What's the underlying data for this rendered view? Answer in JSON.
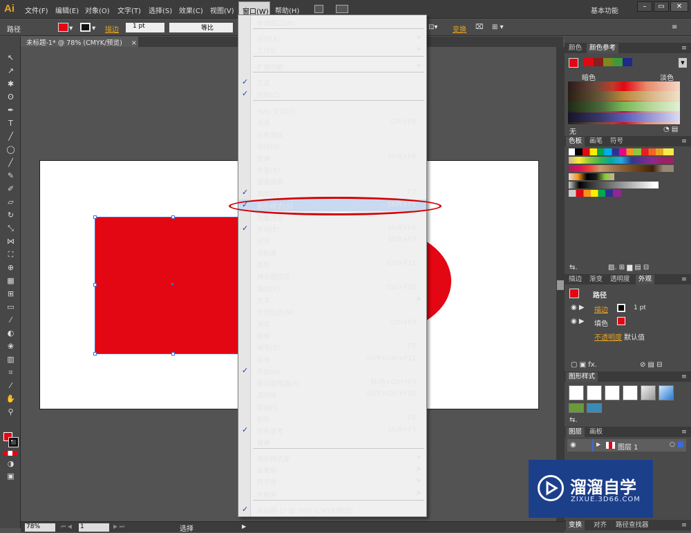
{
  "app": {
    "logo": "Ai",
    "workspace": "基本功能"
  },
  "menubar": {
    "items": [
      "文件(F)",
      "编辑(E)",
      "对象(O)",
      "文字(T)",
      "选择(S)",
      "效果(C)",
      "视图(V)",
      "窗口(W)",
      "帮助(H)"
    ],
    "active": "窗口(W)"
  },
  "window_controls": [
    "–",
    "▭",
    "✕"
  ],
  "control_bar": {
    "object_type": "路径",
    "stroke_label": "描边",
    "stroke_weight": "1 pt",
    "profile_label": "等比",
    "transform_label": "变换"
  },
  "document_tab": {
    "label": "未标题-1* @ 78% (CMYK/预览)",
    "close": "×"
  },
  "status_bar": {
    "zoom": "78%",
    "page": "1",
    "tool": "选择"
  },
  "canvas": {
    "shape_color": "#E30613"
  },
  "window_menu": {
    "highlighted": "图形样式(S)",
    "items": [
      {
        "label": "新建窗口(W)",
        "shortcut": "",
        "checked": false,
        "submenu": false
      },
      {
        "label": "排列(A)",
        "shortcut": "",
        "checked": false,
        "submenu": true
      },
      {
        "label": "工作区",
        "shortcut": "",
        "checked": false,
        "submenu": true
      },
      {
        "label": "扩展功能",
        "shortcut": "",
        "checked": false,
        "submenu": true
      },
      {
        "label": "工具",
        "shortcut": "",
        "checked": true,
        "submenu": false
      },
      {
        "label": "控制(C)",
        "shortcut": "",
        "checked": true,
        "submenu": false
      },
      {
        "label": "SVG 交互(Y)",
        "shortcut": "",
        "checked": false,
        "submenu": false
      },
      {
        "label": "信息",
        "shortcut": "Ctrl+F8",
        "checked": false,
        "submenu": false
      },
      {
        "label": "分色预览",
        "shortcut": "",
        "checked": false,
        "submenu": false
      },
      {
        "label": "动作(N)",
        "shortcut": "",
        "checked": false,
        "submenu": false
      },
      {
        "label": "变换",
        "shortcut": "Shift+F8",
        "checked": false,
        "submenu": false
      },
      {
        "label": "变量(R)",
        "shortcut": "",
        "checked": false,
        "submenu": false
      },
      {
        "label": "图像描摹",
        "shortcut": "",
        "checked": false,
        "submenu": false
      },
      {
        "label": "图层(L)",
        "shortcut": "F7",
        "checked": true,
        "submenu": false
      },
      {
        "label": "图形样式(S)",
        "shortcut": "Shift+F5",
        "checked": true,
        "submenu": false
      },
      {
        "label": "图案选项",
        "shortcut": "",
        "checked": false,
        "submenu": false
      },
      {
        "label": "外观(E)",
        "shortcut": "Shift+F6",
        "checked": true,
        "submenu": false
      },
      {
        "label": "对齐",
        "shortcut": "Shift+F7",
        "checked": false,
        "submenu": false
      },
      {
        "label": "导航器",
        "shortcut": "",
        "checked": false,
        "submenu": false
      },
      {
        "label": "属性",
        "shortcut": "Ctrl+F11",
        "checked": false,
        "submenu": false
      },
      {
        "label": "拼合器预览",
        "shortcut": "",
        "checked": false,
        "submenu": false
      },
      {
        "label": "描边(K)",
        "shortcut": "Ctrl+F10",
        "checked": false,
        "submenu": false
      },
      {
        "label": "文字",
        "shortcut": "",
        "checked": false,
        "submenu": true
      },
      {
        "label": "文档信息(M)",
        "shortcut": "",
        "checked": false,
        "submenu": false
      },
      {
        "label": "渐变",
        "shortcut": "Ctrl+F9",
        "checked": false,
        "submenu": false
      },
      {
        "label": "画板",
        "shortcut": "",
        "checked": false,
        "submenu": false
      },
      {
        "label": "画笔(B)",
        "shortcut": "F5",
        "checked": false,
        "submenu": false
      },
      {
        "label": "符号",
        "shortcut": "Shift+Ctrl+F11",
        "checked": false,
        "submenu": false
      },
      {
        "label": "色板(H)",
        "shortcut": "",
        "checked": true,
        "submenu": false
      },
      {
        "label": "路径查找器(P)",
        "shortcut": "Shift+Ctrl+F9",
        "checked": false,
        "submenu": false
      },
      {
        "label": "透明度",
        "shortcut": "Shift+Ctrl+F10",
        "checked": false,
        "submenu": false
      },
      {
        "label": "链接(I)",
        "shortcut": "",
        "checked": false,
        "submenu": false
      },
      {
        "label": "颜色",
        "shortcut": "F6",
        "checked": false,
        "submenu": false
      },
      {
        "label": "颜色参考",
        "shortcut": "Shift+F3",
        "checked": true,
        "submenu": false
      },
      {
        "label": "魔棒",
        "shortcut": "",
        "checked": false,
        "submenu": false
      },
      {
        "label": "图形样式库",
        "shortcut": "",
        "checked": false,
        "submenu": true
      },
      {
        "label": "画笔库",
        "shortcut": "",
        "checked": false,
        "submenu": true
      },
      {
        "label": "符号库",
        "shortcut": "",
        "checked": false,
        "submenu": true
      },
      {
        "label": "色板库",
        "shortcut": "",
        "checked": false,
        "submenu": true
      },
      {
        "label": "未标题-1* @ 78% (CMYK/预览)",
        "shortcut": "",
        "checked": true,
        "submenu": false
      }
    ]
  },
  "panels": {
    "color_tabs": [
      "颜色",
      "颜色参考"
    ],
    "color_guide": {
      "dark_label": "暗色",
      "light_label": "淡色",
      "none_label": "无"
    },
    "swatch_tabs": [
      "色板",
      "画笔",
      "符号"
    ],
    "appearance_tabs": [
      "描边",
      "渐变",
      "透明度",
      "外观"
    ],
    "appearance": {
      "title": "路径",
      "stroke_label": "描边",
      "stroke_weight": "1 pt",
      "fill_label": "填色",
      "opacity_label": "不透明度",
      "opacity_value": "默认值"
    },
    "graphic_styles_tab": "图形样式",
    "layers_tabs": [
      "图层",
      "画板"
    ],
    "layer_name": "图层 1",
    "bottom_tabs": [
      "变换",
      "对齐",
      "路径查找器"
    ]
  },
  "watermark": {
    "title": "溜溜自学",
    "subtitle": "ZIXUE.3D66.COM"
  }
}
